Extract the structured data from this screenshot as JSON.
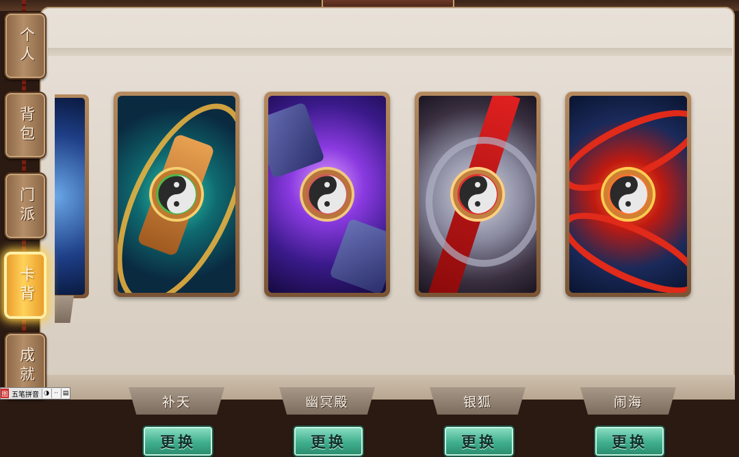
{
  "sidebar": {
    "tabs": [
      {
        "label": "个人",
        "active": false
      },
      {
        "label": "背包",
        "active": false
      },
      {
        "label": "门派",
        "active": false
      },
      {
        "label": "卡背",
        "active": true
      },
      {
        "label": "成就",
        "active": false
      }
    ]
  },
  "cards": [
    {
      "name": "补天",
      "button": "更换",
      "theme": "gold-teal"
    },
    {
      "name": "幽冥殿",
      "button": "更换",
      "theme": "purple"
    },
    {
      "name": "银狐",
      "button": "更换",
      "theme": "silver-red"
    },
    {
      "name": "闹海",
      "button": "更换",
      "theme": "red-blue"
    }
  ],
  "ime": {
    "label": "五笔拼音",
    "logo": "图"
  },
  "colors": {
    "accent": "#ffcc44",
    "button": "#3fae8c",
    "panel": "#e3dbd0"
  }
}
